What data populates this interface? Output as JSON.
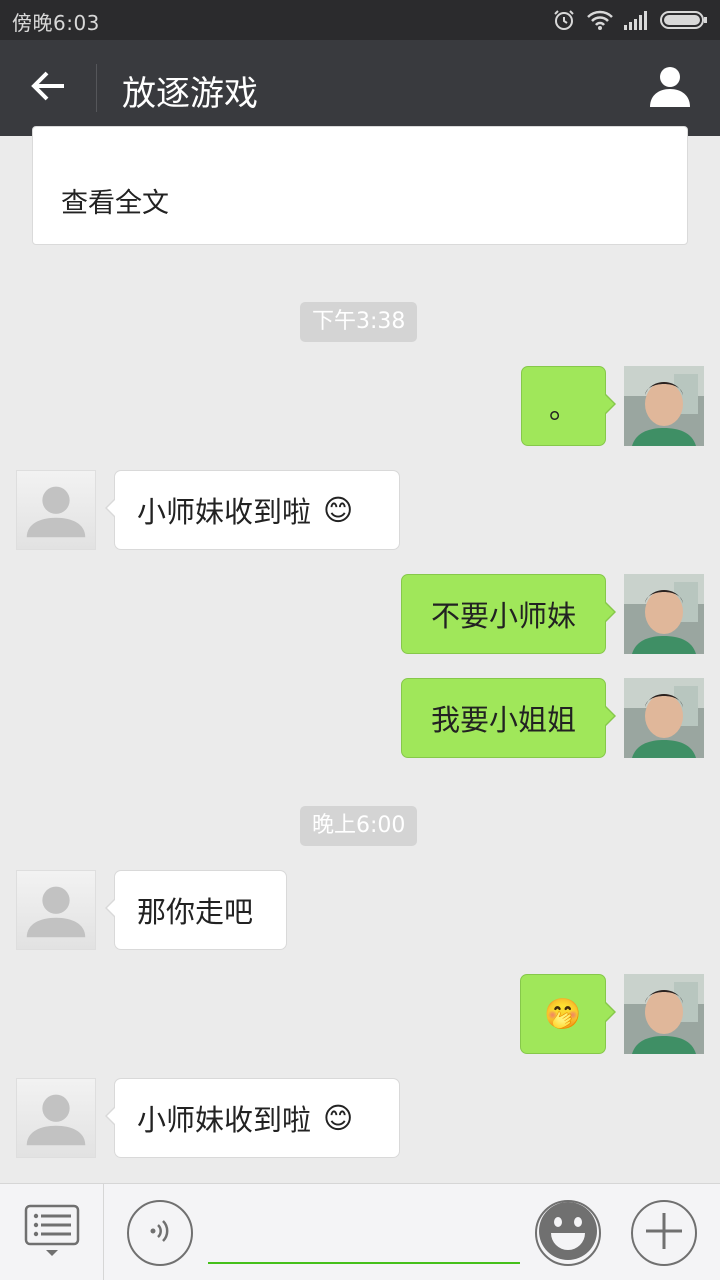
{
  "status_bar": {
    "time": "傍晚6:03"
  },
  "header": {
    "title": "放逐游戏"
  },
  "article_card": {
    "read_more": "查看全文"
  },
  "timestamps": [
    "下午3:38",
    "晚上6:00"
  ],
  "messages": [
    {
      "side": "right",
      "text": "。",
      "emoji": ""
    },
    {
      "side": "left",
      "text": "小师妹收到啦",
      "emoji": "😊"
    },
    {
      "side": "right",
      "text": "不要小师妹",
      "emoji": ""
    },
    {
      "side": "right",
      "text": "我要小姐姐",
      "emoji": ""
    },
    {
      "side": "left",
      "text": "那你走吧",
      "emoji": ""
    },
    {
      "side": "right",
      "text": "",
      "emoji": "🤭"
    },
    {
      "side": "left",
      "text": "小师妹收到啦",
      "emoji": "😊"
    }
  ],
  "input_bar": {
    "message_value": ""
  },
  "colors": {
    "title_bar": "#393a3e",
    "status_bar": "#2b2b2d",
    "sent_bubble": "#a0e75a",
    "received_bubble": "#ffffff",
    "chat_background": "#ebebeb",
    "input_accent": "#45c01a"
  },
  "icons": {
    "back": "arrow-left-icon",
    "profile": "person-icon",
    "menu": "list-menu-icon",
    "voice": "voice-wave-icon",
    "emoji": "smiley-icon",
    "plus": "plus-icon"
  }
}
